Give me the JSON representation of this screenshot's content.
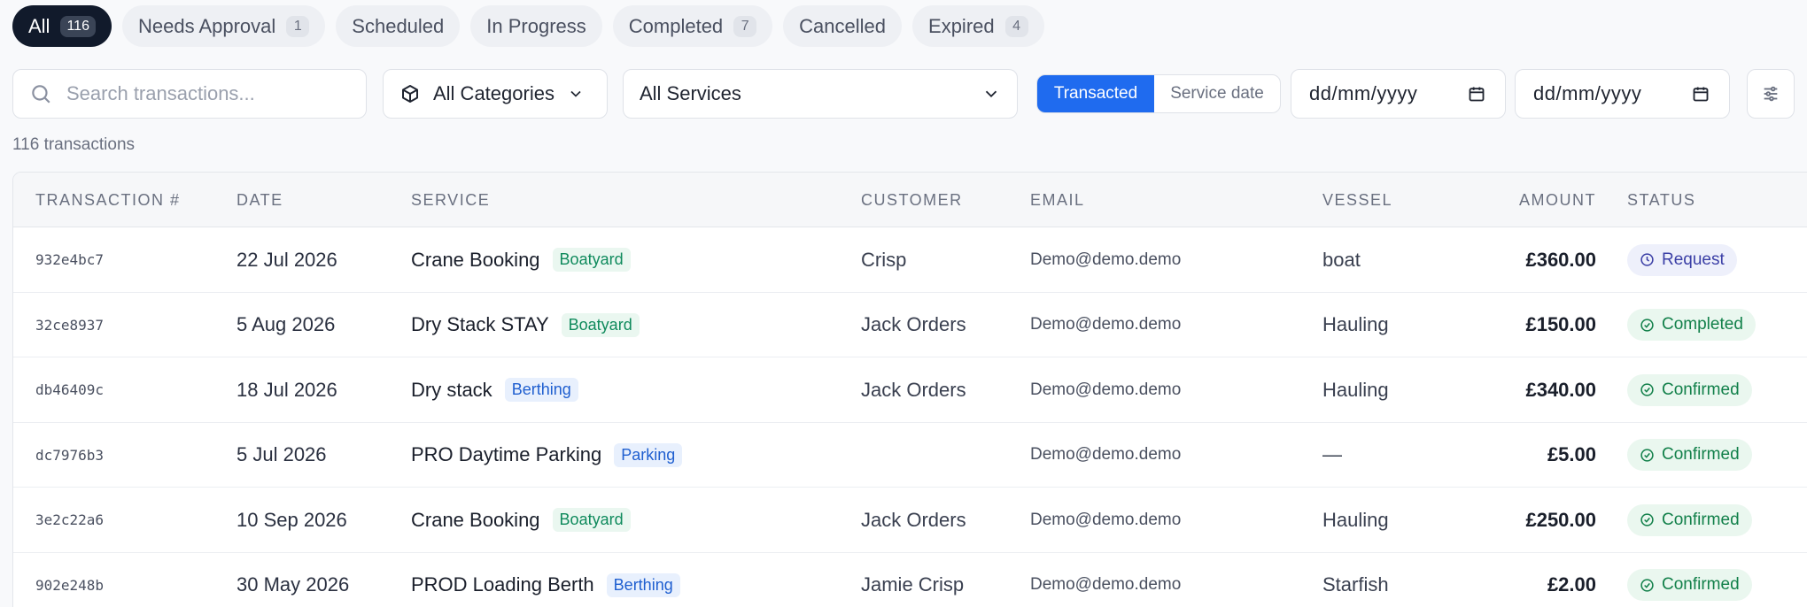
{
  "tabs": [
    {
      "label": "All",
      "count": "116",
      "active": true
    },
    {
      "label": "Needs Approval",
      "count": "1"
    },
    {
      "label": "Scheduled",
      "count": ""
    },
    {
      "label": "In Progress",
      "count": ""
    },
    {
      "label": "Completed",
      "count": "7"
    },
    {
      "label": "Cancelled",
      "count": ""
    },
    {
      "label": "Expired",
      "count": "4"
    }
  ],
  "filters": {
    "search_placeholder": "Search transactions...",
    "category": "All Categories",
    "service": "All Services",
    "date_mode": {
      "active": "Transacted",
      "inactive": "Service date"
    },
    "date_from": "dd/mm/yyyy",
    "date_to": "dd/mm/yyyy",
    "icons": {
      "search": "search-icon",
      "category": "box-icon",
      "chevron": "chevron-down-icon",
      "calendar": "calendar-icon",
      "adjust": "sliders-icon"
    }
  },
  "summary": "116 transactions",
  "table": {
    "headers": [
      "TRANSACTION #",
      "DATE",
      "SERVICE",
      "CUSTOMER",
      "EMAIL",
      "VESSEL",
      "AMOUNT",
      "STATUS"
    ],
    "rows": [
      {
        "id": "932e4bc7",
        "date": "22 Jul 2026",
        "service": "Crane Booking",
        "tag": "Boatyard",
        "tag_color": "green",
        "customer": "Crisp",
        "email": "Demo@demo.demo",
        "vessel": "boat",
        "amount": "£360.00",
        "status": "Request",
        "status_kind": "request"
      },
      {
        "id": "32ce8937",
        "date": "5 Aug 2026",
        "service": "Dry Stack STAY",
        "tag": "Boatyard",
        "tag_color": "green",
        "customer": "Jack Orders",
        "email": "Demo@demo.demo",
        "vessel": "Hauling",
        "amount": "£150.00",
        "status": "Completed",
        "status_kind": "ok"
      },
      {
        "id": "db46409c",
        "date": "18 Jul 2026",
        "service": "Dry stack",
        "tag": "Berthing",
        "tag_color": "blue",
        "customer": "Jack Orders",
        "email": "Demo@demo.demo",
        "vessel": "Hauling",
        "amount": "£340.00",
        "status": "Confirmed",
        "status_kind": "ok"
      },
      {
        "id": "dc7976b3",
        "date": "5 Jul 2026",
        "service": "PRO Daytime Parking",
        "tag": "Parking",
        "tag_color": "blue",
        "customer": "",
        "email": "Demo@demo.demo",
        "vessel": "—",
        "amount": "£5.00",
        "status": "Confirmed",
        "status_kind": "ok"
      },
      {
        "id": "3e2c22a6",
        "date": "10 Sep 2026",
        "service": "Crane Booking",
        "tag": "Boatyard",
        "tag_color": "green",
        "customer": "Jack Orders",
        "email": "Demo@demo.demo",
        "vessel": "Hauling",
        "amount": "£250.00",
        "status": "Confirmed",
        "status_kind": "ok"
      },
      {
        "id": "902e248b",
        "date": "30 May 2026",
        "service": "PROD Loading Berth",
        "tag": "Berthing",
        "tag_color": "blue",
        "customer": "Jamie Crisp",
        "email": "Demo@demo.demo",
        "vessel": "Starfish",
        "amount": "£2.00",
        "status": "Confirmed",
        "status_kind": "ok"
      }
    ]
  },
  "colors": {
    "accent": "#1f6bef",
    "active_tab": "#111a2b",
    "ok": "#12804a",
    "request": "#3b3fa6"
  }
}
